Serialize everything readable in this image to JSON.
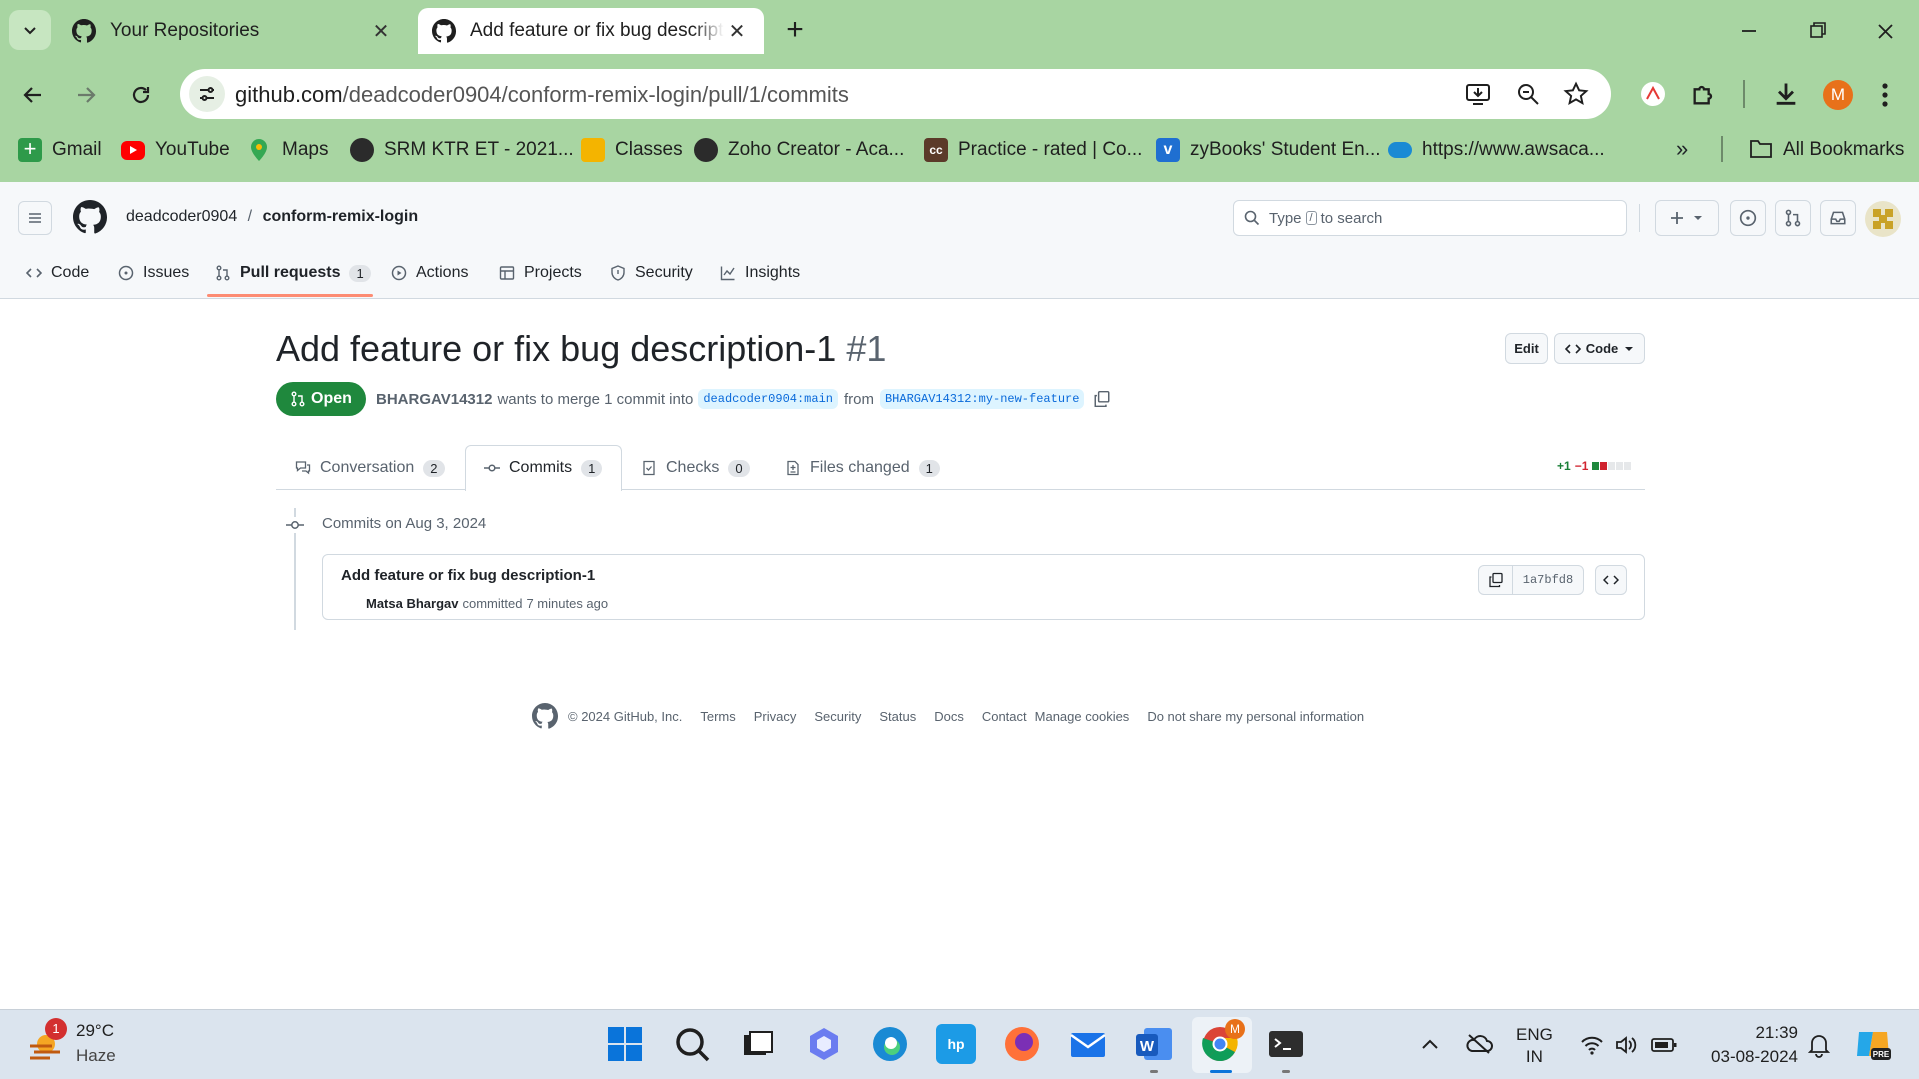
{
  "browser": {
    "tabs": [
      {
        "title": "Your Repositories"
      },
      {
        "title": "Add feature or fix bug descripti"
      }
    ],
    "new_tab": "+",
    "url_host": "github.com",
    "url_path": "/deadcoder0904/conform-remix-login/pull/1/commits",
    "bookmarks": [
      {
        "label": "Gmail"
      },
      {
        "label": "YouTube"
      },
      {
        "label": "Maps"
      },
      {
        "label": "SRM KTR ET - 2021..."
      },
      {
        "label": "Classes"
      },
      {
        "label": "Zoho Creator - Aca..."
      },
      {
        "label": "Practice - rated | Co..."
      },
      {
        "label": "zyBooks' Student En..."
      },
      {
        "label": "https://www.awsaca..."
      }
    ],
    "all_bookmarks": "All Bookmarks",
    "profile_initial": "M"
  },
  "github": {
    "owner": "deadcoder0904",
    "separator": "/",
    "repo": "conform-remix-login",
    "search_placeholder_pre": "Type",
    "search_key": "/",
    "search_placeholder_post": "to search",
    "repo_tabs": [
      {
        "label": "Code"
      },
      {
        "label": "Issues"
      },
      {
        "label": "Pull requests",
        "count": "1"
      },
      {
        "label": "Actions"
      },
      {
        "label": "Projects"
      },
      {
        "label": "Security"
      },
      {
        "label": "Insights"
      }
    ]
  },
  "pr": {
    "title": "Add feature or fix bug description-1",
    "number": "#1",
    "edit_label": "Edit",
    "code_label": "Code",
    "state": "Open",
    "author": "BHARGAV14312",
    "merge_text": "wants to merge 1 commit into",
    "base_branch": "deadcoder0904:main",
    "from_text": "from",
    "head_branch": "BHARGAV14312:my-new-feature",
    "tabs": [
      {
        "label": "Conversation",
        "count": "2"
      },
      {
        "label": "Commits",
        "count": "1"
      },
      {
        "label": "Checks",
        "count": "0"
      },
      {
        "label": "Files changed",
        "count": "1"
      }
    ],
    "additions": "+1",
    "deletions": "−1",
    "commits_date": "Commits on Aug 3, 2024",
    "commit": {
      "message": "Add feature or fix bug description-1",
      "author": "Matsa Bhargav",
      "action": "committed",
      "time": "7 minutes ago",
      "sha": "1a7bfd8"
    }
  },
  "footer": {
    "copyright": "© 2024 GitHub, Inc.",
    "links": [
      "Terms",
      "Privacy",
      "Security",
      "Status",
      "Docs",
      "Contact",
      "Manage cookies",
      "Do not share my personal information"
    ]
  },
  "taskbar": {
    "weather_badge": "1",
    "temperature": "29°C",
    "condition": "Haze",
    "lang_top": "ENG",
    "lang_bottom": "IN",
    "time": "21:39",
    "date": "03-08-2024",
    "chrome_badge": "M"
  },
  "colors": {
    "chrome_bg": "#a8d5a2",
    "open_green": "#1f883d",
    "link_blue": "#0969da",
    "active_underline": "#fd8c73"
  }
}
